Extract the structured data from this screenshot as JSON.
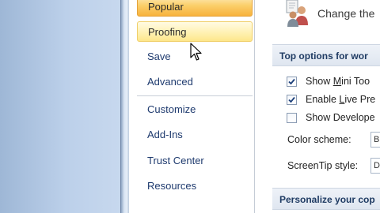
{
  "nav": {
    "items": [
      {
        "label": "Popular",
        "state": "selected"
      },
      {
        "label": "Proofing",
        "state": "hover"
      },
      {
        "label": "Save"
      },
      {
        "label": "Advanced"
      },
      {
        "label": "Customize"
      },
      {
        "label": "Add-Ins"
      },
      {
        "label": "Trust Center"
      },
      {
        "label": "Resources"
      }
    ]
  },
  "main": {
    "header": {
      "text": "Change the",
      "icon": "people-settings-icon"
    },
    "section1": {
      "title": "Top options for wor"
    },
    "options": [
      {
        "pre": "Show ",
        "u": "M",
        "post": "ini Too",
        "checked": true
      },
      {
        "pre": "Enable ",
        "u": "L",
        "post": "ive Pre",
        "checked": true
      },
      {
        "pre": "Show Develope",
        "u": "",
        "post": "",
        "checked": false
      }
    ],
    "color_scheme": {
      "label": "Color scheme:",
      "value": "B"
    },
    "screentip": {
      "label": "ScreenTip style:",
      "value": "D"
    },
    "section2": {
      "title": "Personalize your cop"
    }
  },
  "colors": {
    "selected_item": "#f7b23d",
    "hover_item": "#fde78b",
    "nav_text": "#1e3a6e",
    "section_band": "#dfe6f0"
  }
}
